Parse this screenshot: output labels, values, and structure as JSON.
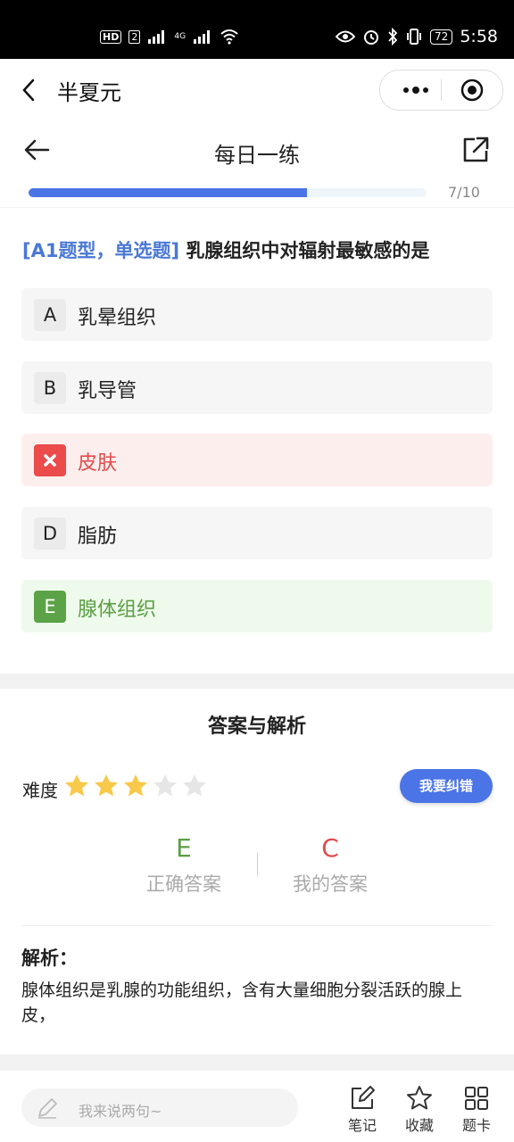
{
  "status_bar": {
    "time": "5:58",
    "battery": "72",
    "hd_label": "HD",
    "sim_label": "2",
    "network_label": "4G"
  },
  "mini_app": {
    "title": "半夏元"
  },
  "nav": {
    "title": "每日一练",
    "progress_text": "7/10",
    "progress_fraction": 0.7
  },
  "question": {
    "tag": "[A1题型，单选题]",
    "text": " 乳腺组织中对辐射最敏感的是",
    "options": [
      {
        "letter": "A",
        "text": "乳晕组织",
        "state": "normal"
      },
      {
        "letter": "B",
        "text": "乳导管",
        "state": "normal"
      },
      {
        "letter": "C",
        "text": "皮肤",
        "state": "wrong"
      },
      {
        "letter": "D",
        "text": "脂肪",
        "state": "normal"
      },
      {
        "letter": "E",
        "text": "腺体组织",
        "state": "correct"
      }
    ]
  },
  "analysis": {
    "title": "答案与解析",
    "difficulty_label": "难度",
    "difficulty_stars": 3,
    "difficulty_max": 5,
    "report_button": "我要纠错",
    "correct_answer": "E",
    "correct_caption": "正确答案",
    "my_answer": "C",
    "my_caption": "我的答案",
    "explanation_title": "解析：",
    "explanation_text": "腺体组织是乳腺的功能组织，含有大量细胞分裂活跃的腺上皮，"
  },
  "bottom_bar": {
    "comment_placeholder": "我来说两句~",
    "notes_label": "笔记",
    "favorite_label": "收藏",
    "card_label": "题卡"
  },
  "colors": {
    "accent": "#4b74e6",
    "correct": "#5ba346",
    "wrong": "#eb4b4b",
    "star_on": "#f8c94a",
    "star_off": "#e6e6e6"
  },
  "icons": {
    "back": "chevron-left-icon",
    "more": "more-dots-icon",
    "close_app": "target-icon",
    "nav_back": "arrow-left-icon",
    "share": "share-icon",
    "wrong_mark": "x-icon",
    "pen": "pen-icon",
    "notes": "edit-icon",
    "favorite": "star-icon",
    "card": "grid-icon"
  }
}
